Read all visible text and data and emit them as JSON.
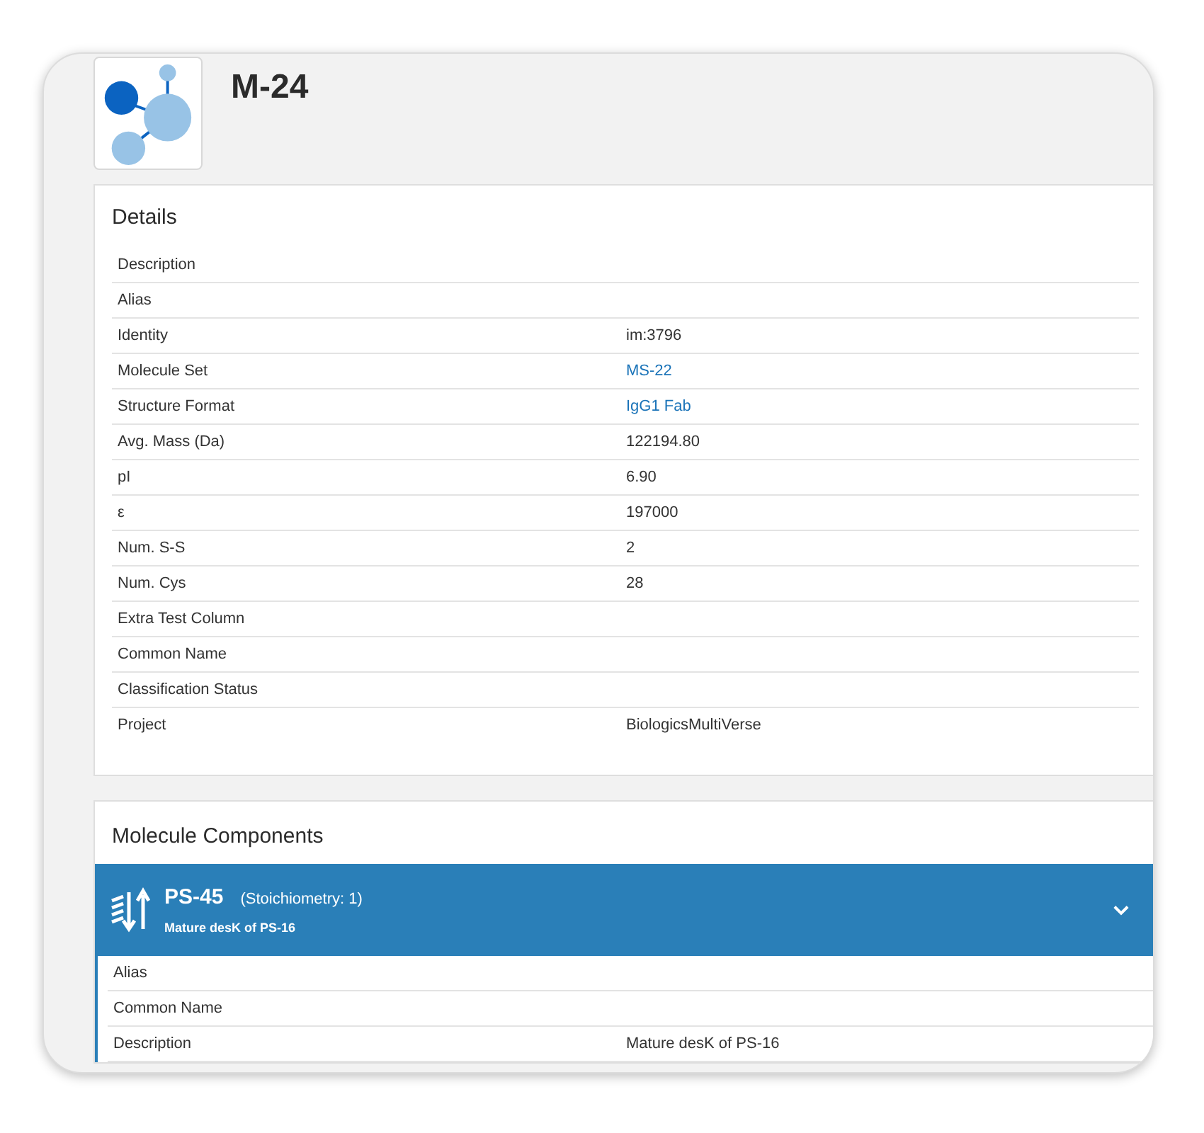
{
  "molecule": {
    "title": "M-24"
  },
  "details": {
    "heading": "Details",
    "rows": [
      {
        "label": "Description",
        "value": ""
      },
      {
        "label": "Alias",
        "value": ""
      },
      {
        "label": "Identity",
        "value": "im:3796",
        "link": false
      },
      {
        "label": "Molecule Set",
        "value": "MS-22",
        "link": true
      },
      {
        "label": "Structure Format",
        "value": "IgG1 Fab",
        "link": true
      },
      {
        "label": "Avg. Mass (Da)",
        "value": "122194.80",
        "link": false
      },
      {
        "label": "pI",
        "value": "6.90",
        "link": false
      },
      {
        "label": "ε",
        "value": "197000",
        "link": false
      },
      {
        "label": "Num. S-S",
        "value": "2",
        "link": false
      },
      {
        "label": "Num. Cys",
        "value": "28",
        "link": false
      },
      {
        "label": "Extra Test Column",
        "value": ""
      },
      {
        "label": "Common Name",
        "value": ""
      },
      {
        "label": "Classification Status",
        "value": ""
      },
      {
        "label": "Project",
        "value": "BiologicsMultiVerse",
        "link": false
      }
    ]
  },
  "components": {
    "heading": "Molecule Components",
    "items": [
      {
        "name": "PS-45",
        "stoichiometry": "(Stoichiometry: 1)",
        "subtitle": "Mature desK of PS-16",
        "expanded": true,
        "rows": [
          {
            "label": "Alias",
            "value": ""
          },
          {
            "label": "Common Name",
            "value": ""
          },
          {
            "label": "Description",
            "value": "Mature desK of PS-16"
          }
        ]
      }
    ]
  }
}
